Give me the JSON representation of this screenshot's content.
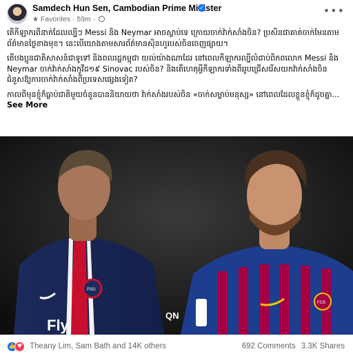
{
  "post": {
    "author": "Samdech Hun Sen, Cambodian Prime Minister",
    "list_label": "Favorites",
    "time": "59m",
    "paragraphs": [
      "តើកីឡាករពីនាក់ដែលល្បីៗ Messi និង Neymar អាចស្លាប់ទេ ក្រោយចាក់វ៉ាក់សាំងចិន? ប្រសិនជាគាត់ចាក់មែនតាមព័ត៌មានថ្ងៃខាងមុខ។ នេះបើយោងតាមសារព័ត៌មានស៊ិនហួរបស់ចិនចេញផ្សាយ។",
      "តើបងប្អូនជាតិសាសន៍ជាទូទៅ និងពលរដ្ឋកម្ពុជា យល់យ៉ាងណាដែរ នៅពេលកីឡាករល្បីលំដាប់ពិភពលោក Messi និង Neymar ចាក់វ៉ាក់សាំងកូវីដ១៩ Sinovac របស់ចិន? និងតើហេតុអ្វីកីឡាករទាំងពីររូបជ្រើសរើសយកវ៉ាក់សាំងចិនជំនួសឱ្យការចាក់វ៉ាក់សាំងពីប្រទេសផ្សេងទៀត?",
      "កាលពីមុនខ្ញុំក៏ធ្លាប់ជាតិមួយចំនួនបាននិយាយថា វ៉ាក់សាំងរបស់ចិន «ចាក់សម្លាប់មនុស្ស» នៅពេលដែលខ្លួនខ្ញុំក៏ដូចគ្នា..."
    ],
    "see_more": "See More"
  },
  "photo": {
    "left_kit_sponsor": "Fly",
    "left_kit_sponsor_2": "QN",
    "left_club_badge": "PSG",
    "right_club_badge": "FCB"
  },
  "footer": {
    "reaction_names": "Theany Lim, Sam Bath and 14K others",
    "comments": "692 Comments",
    "shares": "3.3K Shares"
  },
  "colors": {
    "accent": "#1877f2",
    "love": "#f33e58",
    "muted": "#65676b"
  },
  "icons": [
    "verified-badge-icon",
    "star-icon",
    "globe-icon",
    "more-options-icon",
    "like-reaction-icon",
    "love-reaction-icon"
  ]
}
